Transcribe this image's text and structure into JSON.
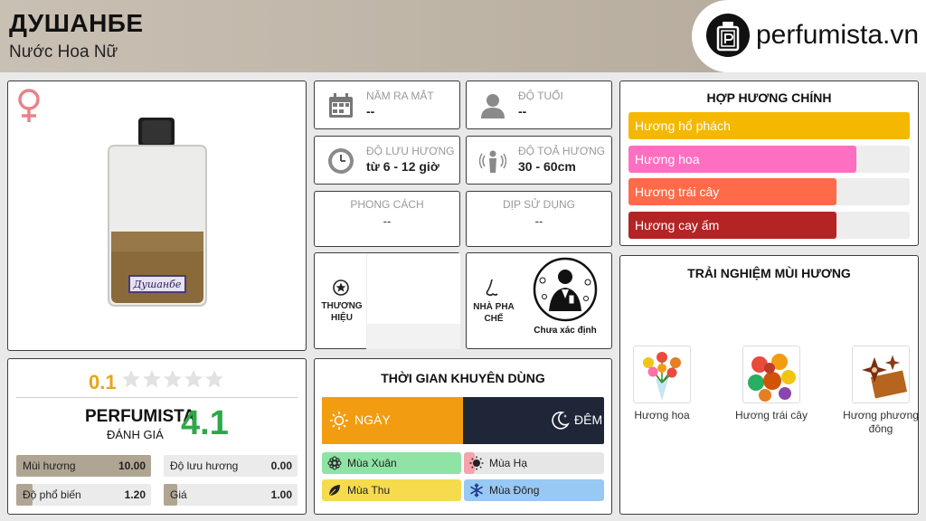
{
  "header": {
    "title": "ДУШАНБЕ",
    "subtitle": "Nước Hoa Nữ",
    "logo_text": "perfumista.vn"
  },
  "product": {
    "gender_icon": "venus-icon",
    "bottle_label": "Душанбе"
  },
  "rating": {
    "user_score": "0.1",
    "star_count": 5,
    "filled_stars": 0,
    "perfumista_label": "PERFUMISTA",
    "perfumista_sub": "ĐÁNH GIÁ",
    "perfumista_score": "4.1",
    "stats": [
      {
        "label": "Mùi hương",
        "value": "10.00",
        "fraction": 1.0
      },
      {
        "label": "Độ lưu hương",
        "value": "0.00",
        "fraction": 0.0
      },
      {
        "label": "Độ phổ biến",
        "value": "1.20",
        "fraction": 0.12
      },
      {
        "label": "Giá",
        "value": "1.00",
        "fraction": 0.1
      }
    ]
  },
  "info": {
    "release": {
      "label": "NĂM RA MẮT",
      "value": "--"
    },
    "age": {
      "label": "ĐỘ TUỔI",
      "value": "--"
    },
    "longevity": {
      "label": "ĐỘ LƯU HƯƠNG",
      "value": "từ 6 - 12 giờ"
    },
    "sillage": {
      "label": "ĐỘ TOẢ HƯƠNG",
      "value": "30 - 60cm"
    },
    "style": {
      "label": "PHONG CÁCH",
      "value": "--"
    },
    "occasion": {
      "label": "DỊP SỬ DỤNG",
      "value": "--"
    },
    "brand": {
      "label": "THƯƠNG HIỆU"
    },
    "perfumer": {
      "label": "NHÀ PHA CHẾ",
      "name": "Chưa xác định"
    }
  },
  "time": {
    "title": "THỜI GIAN KHUYÊN DÙNG",
    "day_label": "NGÀY",
    "night_label": "ĐÊM",
    "day_fraction": 0.5,
    "seasons": [
      {
        "label": "Mùa Xuân",
        "color": "#8fe3a4",
        "fraction": 1.0,
        "icon": "flower-icon"
      },
      {
        "label": "Mùa Hạ",
        "color": "#f5a3ad",
        "fraction": 0.08,
        "icon": "sun-icon"
      },
      {
        "label": "Mùa Thu",
        "color": "#f6dc4d",
        "fraction": 1.0,
        "icon": "leaf-icon"
      },
      {
        "label": "Mùa Đông",
        "color": "#98c8f4",
        "fraction": 1.0,
        "icon": "snowflake-icon"
      }
    ]
  },
  "accords": {
    "title": "HỢP HƯƠNG CHÍNH",
    "items": [
      {
        "label": "Hương hổ phách",
        "color": "#f5b800",
        "fraction": 1.0
      },
      {
        "label": "Hương hoa",
        "color": "#ff6fc1",
        "fraction": 0.81
      },
      {
        "label": "Hương trái cây",
        "color": "#ff6a49",
        "fraction": 0.74
      },
      {
        "label": "Hương cay ấm",
        "color": "#b52424",
        "fraction": 0.74
      }
    ]
  },
  "notes": {
    "title": "TRẢI NGHIỆM MÙI HƯƠNG",
    "items": [
      {
        "label": "Hương hoa"
      },
      {
        "label": "Hương trái cây"
      },
      {
        "label": "Hương phương đông"
      }
    ]
  }
}
